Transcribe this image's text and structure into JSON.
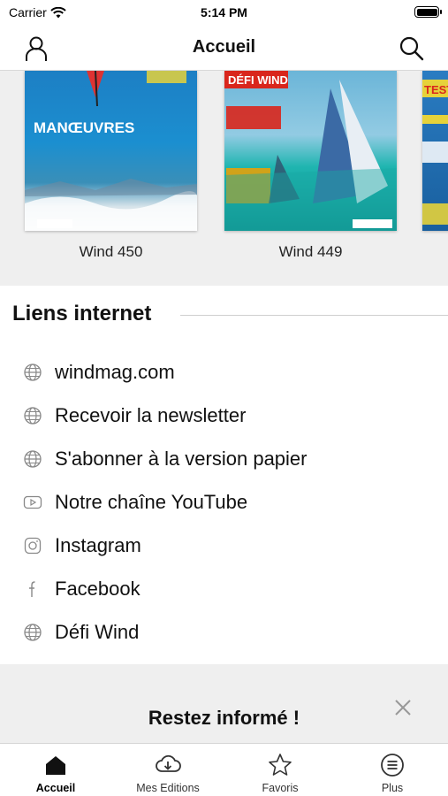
{
  "status": {
    "carrier": "Carrier",
    "time": "5:14 PM"
  },
  "nav": {
    "title": "Accueil",
    "profile_icon": "person-icon",
    "search_icon": "search-icon"
  },
  "carousel": {
    "items": [
      {
        "label": "Wind 450",
        "cover_text": "MANŒUVRES"
      },
      {
        "label": "Wind 449",
        "cover_text": "DÉFI WIND"
      },
      {
        "label": "",
        "cover_text": "TEST"
      }
    ]
  },
  "links": {
    "heading": "Liens internet",
    "items": [
      {
        "label": "windmag.com",
        "icon": "globe-icon"
      },
      {
        "label": "Recevoir la newsletter",
        "icon": "globe-icon"
      },
      {
        "label": "S'abonner à la version papier",
        "icon": "globe-icon"
      },
      {
        "label": "Notre chaîne YouTube",
        "icon": "youtube-icon"
      },
      {
        "label": "Instagram",
        "icon": "instagram-icon"
      },
      {
        "label": "Facebook",
        "icon": "facebook-icon"
      },
      {
        "label": "Défi Wind",
        "icon": "globe-icon"
      }
    ]
  },
  "banner": {
    "title": "Restez informé !",
    "close_icon": "close-icon"
  },
  "tabs": [
    {
      "label": "Accueil",
      "icon": "home-icon",
      "active": true
    },
    {
      "label": "Mes Editions",
      "icon": "cloud-download-icon",
      "active": false
    },
    {
      "label": "Favoris",
      "icon": "star-icon",
      "active": false
    },
    {
      "label": "Plus",
      "icon": "menu-icon",
      "active": false
    }
  ],
  "colors": {
    "accent": "#111111",
    "background_gray": "#efefef",
    "divider": "#d9d9d9"
  }
}
